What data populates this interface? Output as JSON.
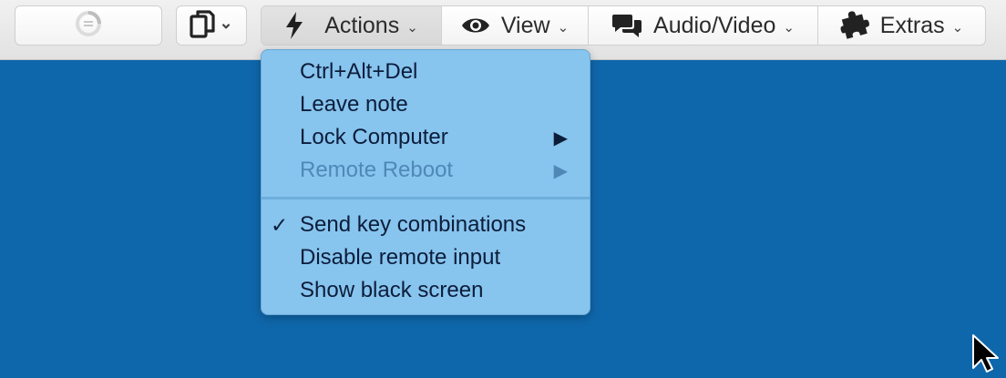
{
  "toolbar": {
    "status_icon": "loading-spinner-icon",
    "clipboard_icon": "copy-pages-icon",
    "clipboard_caret": "⌄",
    "segments": [
      {
        "label": "Actions",
        "icon": "lightning-icon",
        "caret": "⌄"
      },
      {
        "label": "View",
        "icon": "eye-icon",
        "caret": "⌄"
      },
      {
        "label": "Audio/Video",
        "icon": "chat-bubbles-icon",
        "caret": "⌄"
      },
      {
        "label": "Extras",
        "icon": "puzzle-icon",
        "caret": "⌄"
      }
    ]
  },
  "actions_menu": {
    "items": [
      {
        "label": "Ctrl+Alt+Del"
      },
      {
        "label": "Leave note"
      },
      {
        "label": "Lock Computer",
        "submenu_arrow": "▶"
      },
      {
        "label": "Remote Reboot",
        "submenu_arrow": "▶",
        "disabled": true
      },
      {
        "label": "Send key combinations",
        "checkmark": "✓",
        "checked": true
      },
      {
        "label": "Disable remote input"
      },
      {
        "label": "Show black screen"
      }
    ]
  },
  "colors": {
    "remote_background": "#0f67ab",
    "menu_background": "#87c4ee",
    "menu_text": "#0c1d3a",
    "menu_disabled_text": "#4f88b6",
    "toolbar_background": "#e9e9e9"
  }
}
